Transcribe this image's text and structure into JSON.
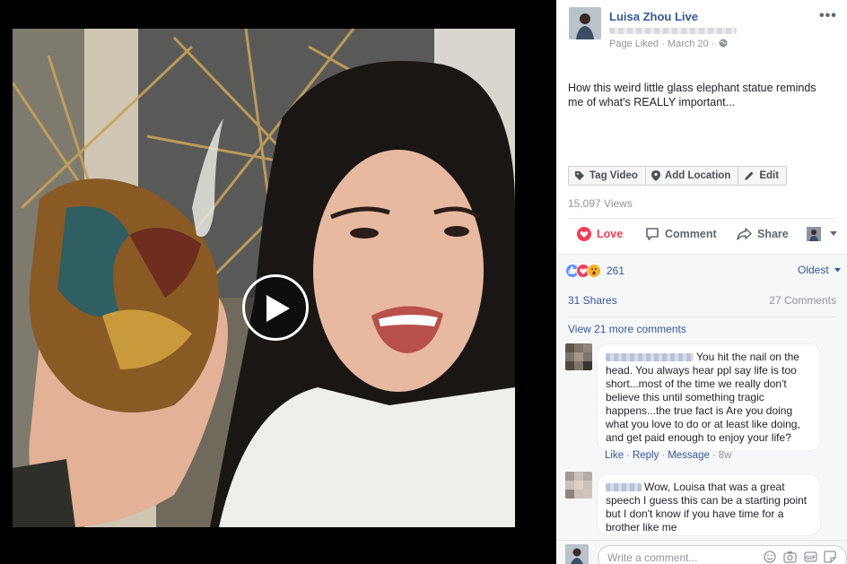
{
  "post": {
    "page_name": "Luisa Zhou Live",
    "meta": "Page Liked · March 20 ·",
    "text": "How this weird little glass elephant statue reminds me of what's REALLY important...",
    "more": "•••"
  },
  "tag_bar": {
    "tag_video": "Tag Video",
    "add_location": "Add Location",
    "edit": "Edit"
  },
  "views": "15,097 Views",
  "actions": {
    "love": "Love",
    "comment": "Comment",
    "share": "Share"
  },
  "reactions": {
    "count": "261",
    "sort": "Oldest"
  },
  "engagement": {
    "shares": "31 Shares",
    "comments": "27 Comments",
    "view_more": "View 21 more comments"
  },
  "comments": [
    {
      "text": "You hit the nail on the head. You always hear ppl say life is too short...most of the time we really don't believe this until something tragic happens...the true fact is Are you doing what you love to do or at least like doing, and get paid enough to enjoy your life?",
      "like": "Like",
      "reply": "Reply",
      "message": "Message",
      "time": "8w"
    },
    {
      "text": "Wow, Louisa that was a great speech I guess this can be a starting point but I don't know if you have time for a brother like me"
    }
  ],
  "compose": {
    "placeholder": "Write a comment..."
  },
  "colors": {
    "link": "#365899",
    "love": "#f33e58",
    "like": "#5890ff",
    "wow": "#f7b125"
  }
}
